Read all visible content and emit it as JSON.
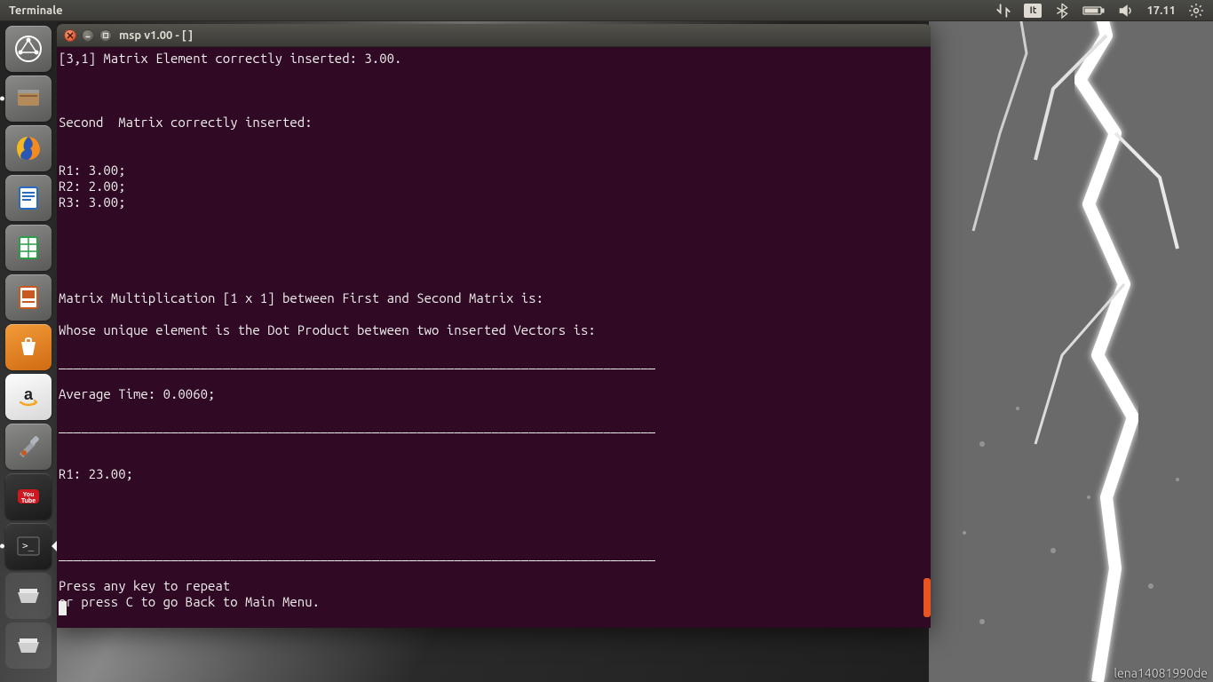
{
  "top_panel": {
    "active_app": "Terminale",
    "keyboard_layout": "It",
    "clock": "17.11"
  },
  "launcher": {
    "items": [
      {
        "name": "dash"
      },
      {
        "name": "files"
      },
      {
        "name": "firefox"
      },
      {
        "name": "writer"
      },
      {
        "name": "calc"
      },
      {
        "name": "impress"
      },
      {
        "name": "software-center"
      },
      {
        "name": "amazon"
      },
      {
        "name": "settings"
      },
      {
        "name": "youtube"
      },
      {
        "name": "terminal"
      },
      {
        "name": "device-1"
      },
      {
        "name": "device-2"
      }
    ]
  },
  "terminal": {
    "title": "msp v1.00 - [ ]",
    "lines": {
      "l01": "[3,1] Matrix Element correctly inserted: 3.00.",
      "l02": "",
      "l03": "",
      "l04": "",
      "l05": "Second  Matrix correctly inserted:",
      "l06": "",
      "l07": "",
      "l08": "R1: 3.00;",
      "l09": "R2: 2.00;",
      "l10": "R3: 3.00;",
      "l11": "",
      "l12": "",
      "l13": "",
      "l14": "",
      "l15": "",
      "l16": "Matrix Multiplication [1 x 1] between First and Second Matrix is:",
      "l17": "",
      "l18": "Whose unique element is the Dot Product between two inserted Vectors is:",
      "l19": "",
      "l20": "________________________________________________________________________________",
      "l21": "",
      "l22": "Average Time: 0.0060;",
      "l23": "",
      "l24": "________________________________________________________________________________",
      "l25": "",
      "l26": "",
      "l27": "R1: 23.00;",
      "l28": "",
      "l29": "",
      "l30": "",
      "l31": "",
      "l32": "________________________________________________________________________________",
      "l33": "",
      "l34": "Press any key to repeat",
      "l35": "or press C to go Back to Main Menu."
    }
  },
  "watermark": "lena14081990de"
}
